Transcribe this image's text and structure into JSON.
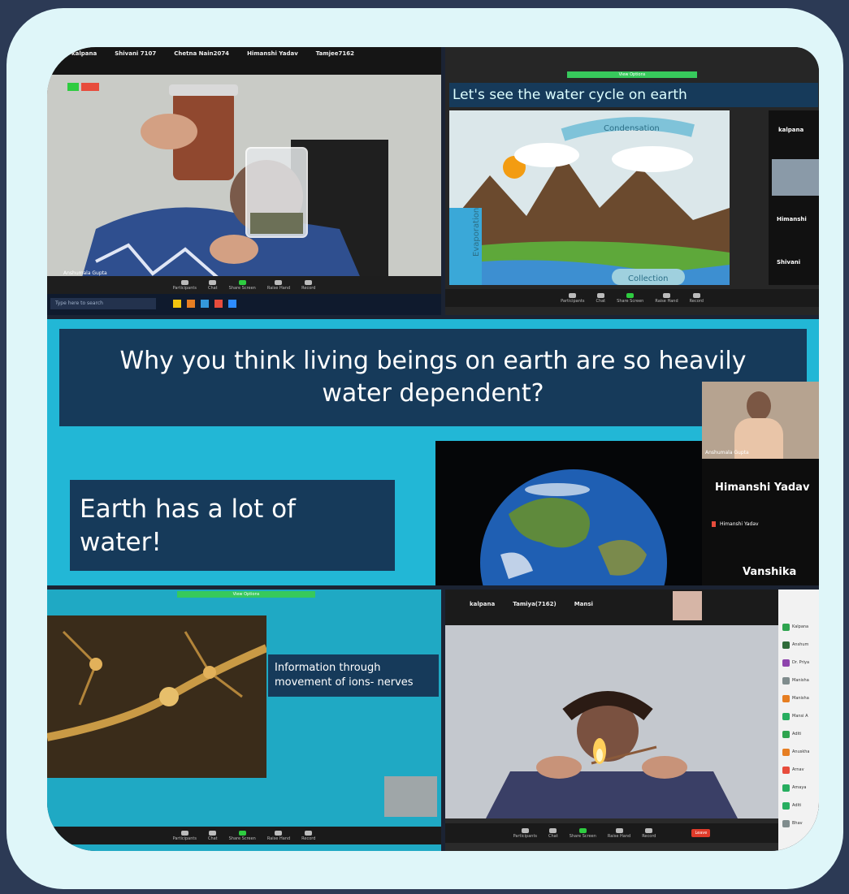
{
  "panel1": {
    "top_names": [
      "kalpana",
      "Shivani 7107",
      "Chetna Nain2074",
      "Himanshi Yadav",
      "Tamjee7162"
    ],
    "speaker_label": "Anshumala Gupta",
    "taskbar_search": "Type here to search",
    "controls": [
      "Participants",
      "Chat",
      "Share Screen",
      "Raise Hand",
      "Record"
    ]
  },
  "panel2": {
    "slide_title": "Let's see the water cycle on earth",
    "banner": "View Options",
    "labels": {
      "condensation": "Condensation",
      "evaporation": "Evaporation",
      "collection": "Collection"
    },
    "side_names": [
      "kalpana",
      "Himanshi",
      "Shivani"
    ],
    "controls": [
      "Participants",
      "Chat",
      "Share Screen",
      "Raise Hand",
      "Record"
    ]
  },
  "panel3": {
    "question": "Why you think living beings on earth are so heavily water dependent?",
    "answer": "Earth has a lot of water!",
    "presenter_label": "Anshumala Gupta",
    "side_names": [
      "Himanshi Yadav",
      "Himanshi Yadav",
      "Vanshika"
    ]
  },
  "panel4": {
    "banner": "View Options",
    "caption": "Information through movement of ions- nerves",
    "controls": [
      "Participants",
      "Chat",
      "Share Screen",
      "Raise Hand",
      "Record"
    ]
  },
  "panel5": {
    "top_names": [
      "kalpana",
      "Tamiya(7162)",
      "Mansi"
    ],
    "participants": [
      "Kalpana",
      "Anshum",
      "Dr. Priya",
      "Manisha",
      "Manisha",
      "Mansi A",
      "Aditi",
      "Anuskha",
      "Arnav",
      "Amaya",
      "Aditi",
      "Bhav"
    ],
    "avatar_colors": [
      "#2ea44f",
      "#2f6b3a",
      "#8e44ad",
      "#7f8c8d",
      "#e67e22",
      "#27ae60",
      "#2ea44f",
      "#e67e22",
      "#e74c3c",
      "#27ae60",
      "#27ae60",
      "#7f8c8d"
    ],
    "controls": [
      "Participants",
      "Chat",
      "Share Screen",
      "Raise Hand",
      "Record"
    ],
    "leave": "Leave"
  },
  "colors": {
    "frame": "#dff6f9",
    "background": "#2c3a55",
    "slide_cyan": "#22b7d6",
    "slide_navy": "#163a5a"
  }
}
